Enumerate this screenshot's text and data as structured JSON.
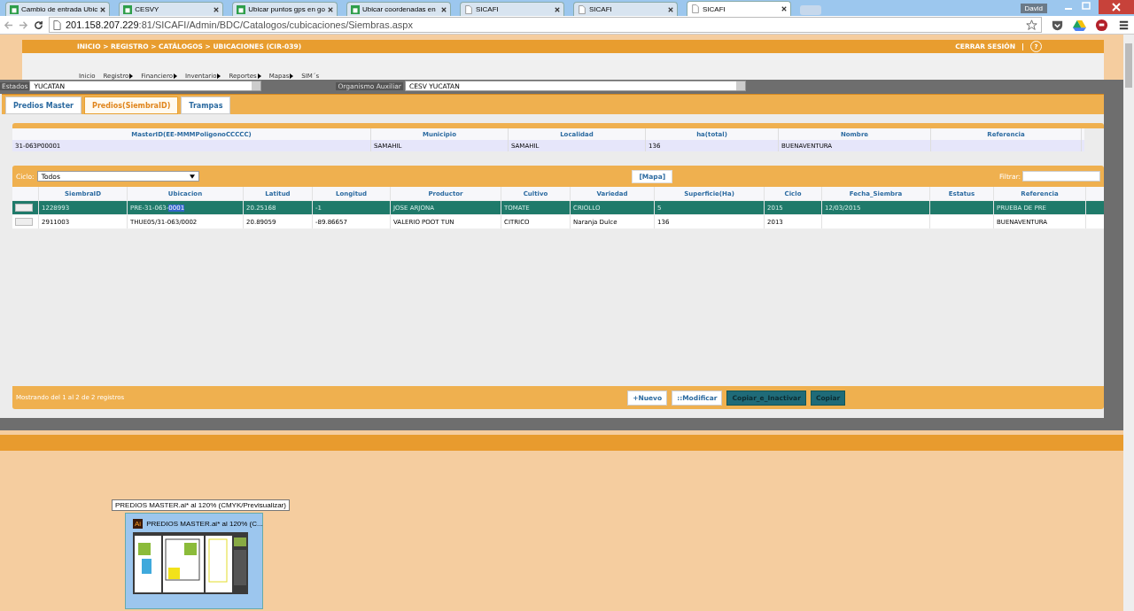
{
  "browser": {
    "tabs": [
      {
        "title": "Cambio de entrada Ubic",
        "kind": "sheet",
        "selected": false
      },
      {
        "title": "CESVY",
        "kind": "sheet",
        "selected": false
      },
      {
        "title": "Ubicar puntos gps en go",
        "kind": "sheet",
        "selected": false
      },
      {
        "title": "Ubicar coordenadas en",
        "kind": "sheet",
        "selected": false
      },
      {
        "title": "SICAFI",
        "kind": "page",
        "selected": false
      },
      {
        "title": "SICAFI",
        "kind": "page",
        "selected": false
      },
      {
        "title": "SICAFI",
        "kind": "page",
        "selected": true
      }
    ],
    "user": "David",
    "url_host": "201.158.207.229",
    "url_rest": ":81/SICAFI/Admin/BDC/Catalogos/cubicaciones/Siembras.aspx"
  },
  "header": {
    "breadcrumb": "INICIO > REGISTRO > CATÁLOGOS > UBICACIONES (CIR-039)",
    "logout": "CERRAR SESIÓN",
    "help": "?"
  },
  "menu": [
    {
      "label": "Inicio",
      "has_submenu": false
    },
    {
      "label": "Registro",
      "has_submenu": true
    },
    {
      "label": "Financiero",
      "has_submenu": true
    },
    {
      "label": "Inventario",
      "has_submenu": true
    },
    {
      "label": "Reportes",
      "has_submenu": true
    },
    {
      "label": "Mapas",
      "has_submenu": true
    },
    {
      "label": "SIM´s",
      "has_submenu": false
    }
  ],
  "filters": {
    "estados_label": "Estados",
    "estados_value": "YUCATAN",
    "organismo_label": "Organismo Auxiliar",
    "organismo_value": "CESV YUCATAN"
  },
  "tabs": [
    {
      "label": "Predios Master",
      "selected": false
    },
    {
      "label": "Predios(SiembraID)",
      "selected": true
    },
    {
      "label": "Trampas",
      "selected": false
    }
  ],
  "master_table": {
    "columns": [
      "MasterID(EE-MMMPoligonoCCCCC)",
      "Municipio",
      "Localidad",
      "ha(total)",
      "Nombre",
      "Referencia"
    ],
    "rows": [
      [
        "31-063P00001",
        "SAMAHIL",
        "SAMAHIL",
        "136",
        "BUENAVENTURA",
        ""
      ]
    ]
  },
  "siembras": {
    "ciclo_label": "Ciclo:",
    "ciclo_value": "Todos",
    "map_button": "[Mapa]",
    "filter_label": "Filtrar:",
    "columns": [
      "SiembraID",
      "Ubicacion",
      "Latitud",
      "Longitud",
      "Productor",
      "Cultivo",
      "Variedad",
      "Superficie(Ha)",
      "Ciclo",
      "Fecha_Siembra",
      "Estatus",
      "Referencia"
    ],
    "rows": [
      {
        "selected": true,
        "cells": [
          "1228993",
          "PRE-31-063-",
          "20.25168",
          "-1",
          "JOSE ARJONA",
          "TOMATE",
          "CRIOLLO",
          "5",
          "2015",
          "12/03/2015",
          "",
          "PRUEBA DE PRE"
        ],
        "highlighted_part": "0001"
      },
      {
        "selected": false,
        "cells": [
          "2911003",
          "THUE05/31-063/0002",
          "20.89059",
          "-89.86657",
          "VALERIO POOT TUN",
          "CITRICO",
          "Naranja Dulce",
          "136",
          "2013",
          "",
          "",
          "BUENAVENTURA"
        ]
      }
    ],
    "status": "Mostrando del 1 al 2 de 2 registros",
    "buttons": [
      {
        "label": "+Nuevo",
        "kind": "light"
      },
      {
        "label": "::Modificar",
        "kind": "light"
      },
      {
        "label": "Copiar_e_Inactivar",
        "kind": "dark"
      },
      {
        "label": "Copiar",
        "kind": "dark"
      }
    ]
  },
  "taskbar_preview": {
    "tooltip": "PREDIOS MASTER.ai* al 120% (CMYK/Previsualizar)",
    "app_icon": "Ai",
    "title": "PREDIOS MASTER.ai* al 120% (C..."
  }
}
